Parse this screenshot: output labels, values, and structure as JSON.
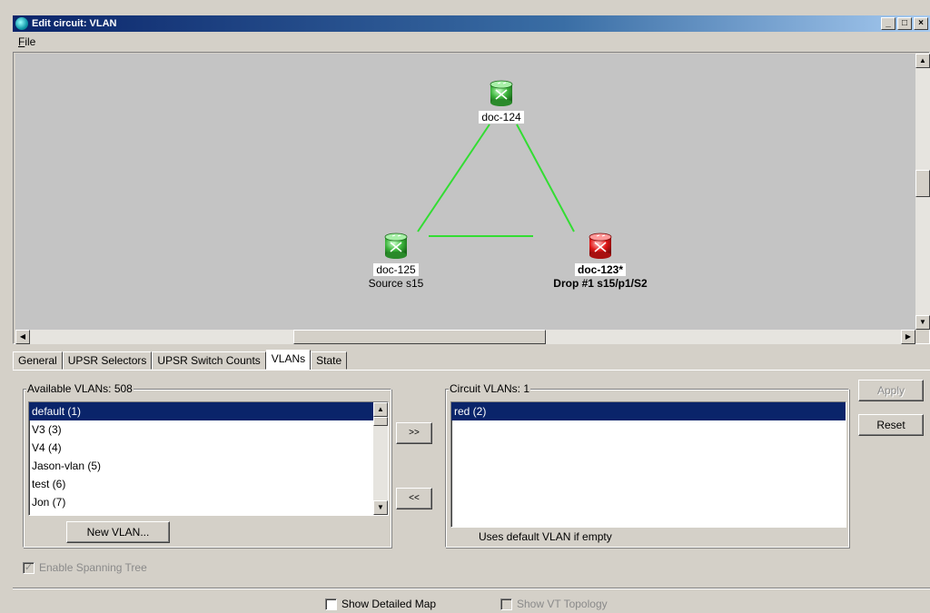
{
  "window": {
    "title": "Edit circuit: VLAN",
    "controls": {
      "minimize": "_",
      "maximize": "□",
      "close": "×"
    }
  },
  "menubar": {
    "items": [
      "File"
    ]
  },
  "map": {
    "background": "#c4c4c4",
    "link_color": "#33dd33",
    "nodes": [
      {
        "name": "doc-124",
        "label": "doc-124",
        "sublabel": "",
        "color": "green",
        "bold": false
      },
      {
        "name": "doc-125",
        "label": "doc-125",
        "sublabel": "Source s15",
        "color": "green",
        "bold": false
      },
      {
        "name": "doc-123",
        "label": "doc-123*",
        "sublabel": "Drop #1 s15/p1/S2",
        "color": "red",
        "bold": true
      }
    ]
  },
  "tabs": [
    {
      "label": "General",
      "active": false
    },
    {
      "label": "UPSR Selectors",
      "active": false
    },
    {
      "label": "UPSR Switch Counts",
      "active": false
    },
    {
      "label": "VLANs",
      "active": true
    },
    {
      "label": "State",
      "active": false
    }
  ],
  "available_vlans": {
    "title": "Available VLANs: 508",
    "items": [
      "default (1)",
      "V3 (3)",
      "V4 (4)",
      "Jason-vlan (5)",
      "test (6)",
      "Jon (7)"
    ],
    "selected_index": 0,
    "new_button": "New VLAN..."
  },
  "transfer": {
    "add": ">>",
    "remove": "<<"
  },
  "circuit_vlans": {
    "title": "Circuit VLANs: 1",
    "items": [
      "red (2)"
    ],
    "selected_index": 0,
    "hint": "Uses default VLAN if empty"
  },
  "actions": {
    "apply": "Apply",
    "reset": "Reset"
  },
  "spanning_tree": {
    "label": "Enable Spanning Tree",
    "checked": true,
    "enabled": false
  },
  "bottom": {
    "show_detailed_map": {
      "label": "Show Detailed Map",
      "checked": false
    },
    "show_vt_topology": {
      "label": "Show VT Topology",
      "checked": false,
      "enabled": false
    }
  },
  "colors": {
    "selection": "#0a246a",
    "title_bar": "#0a246a",
    "node_green": "#3cb43c",
    "node_red": "#e01818"
  }
}
